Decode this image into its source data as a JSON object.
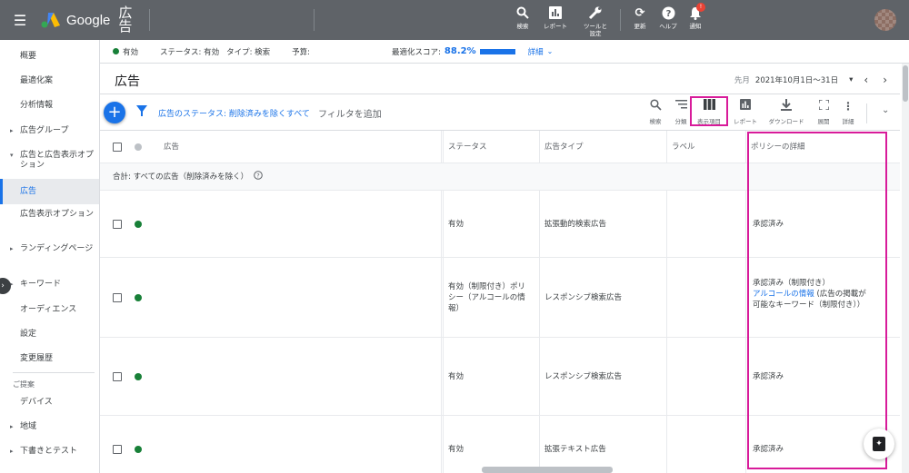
{
  "topbar": {
    "logo_text": "Google",
    "product": "広告",
    "tools": [
      {
        "icon": "search-icon",
        "label": "検索"
      },
      {
        "icon": "reports-icon",
        "label": "レポート"
      },
      {
        "icon": "wrench-icon",
        "label": "ツールと設定"
      },
      {
        "icon": "refresh-icon",
        "label": "更新"
      },
      {
        "icon": "help-icon",
        "label": "ヘルプ"
      },
      {
        "icon": "bell-icon",
        "label": "通知",
        "badge": "!"
      }
    ]
  },
  "sidebar": {
    "items": [
      {
        "label": "概要"
      },
      {
        "label": "最適化案"
      },
      {
        "label": "分析情報"
      },
      {
        "label": "広告グループ"
      },
      {
        "label": "広告と広告表示オプション"
      },
      {
        "label": "広告"
      },
      {
        "label": "広告表示オプション"
      },
      {
        "label": "ランディングページ"
      },
      {
        "label": "キーワード"
      },
      {
        "label": "オーディエンス"
      },
      {
        "label": "設定"
      },
      {
        "label": "変更履歴"
      },
      {
        "label": "デバイス"
      },
      {
        "label": "地域"
      },
      {
        "label": "下書きとテスト"
      }
    ],
    "section_label": "ご提案"
  },
  "statusbar": {
    "status": "有効",
    "status_label": "ステータス: 有効",
    "type_label": "タイプ: 検索",
    "budget_label": "予算:",
    "score_label": "最適化スコア:",
    "score_value": "88.2%",
    "score_fraction": 0.882,
    "details": "詳細"
  },
  "header": {
    "title": "広告",
    "date_prefix": "先月",
    "date_range": "2021年10月1日～31日"
  },
  "toolbar": {
    "filter_text": "広告のステータス: 削除済みを除くすべて",
    "add_filter": "フィルタを追加",
    "buttons": [
      {
        "icon": "search-icon",
        "label": "検索"
      },
      {
        "icon": "segment-icon",
        "label": "分類"
      },
      {
        "icon": "columns-icon",
        "label": "表示項目"
      },
      {
        "icon": "reports-icon",
        "label": "レポート"
      },
      {
        "icon": "download-icon",
        "label": "ダウンロード"
      },
      {
        "icon": "expand-icon",
        "label": "展開"
      },
      {
        "icon": "more-icon",
        "label": "詳細"
      }
    ]
  },
  "table": {
    "headers": {
      "ad": "広告",
      "status": "ステータス",
      "ad_type": "広告タイプ",
      "label": "ラベル",
      "policy": "ポリシーの詳細"
    },
    "total_row": "合計: すべての広告（削除済みを除く）",
    "rows": [
      {
        "status": "有効",
        "ad_type": "拡張動的検索広告",
        "policy": "承認済み"
      },
      {
        "status": "有効（制限付き）ポリシー（アルコールの情報）",
        "ad_type": "レスポンシブ検索広告",
        "policy_prefix": "承認済み（制限付き）",
        "policy_link": "アルコールの情報",
        "policy_suffix": "(広告の掲載が可能なキーワード（制限付き））"
      },
      {
        "status": "有効",
        "ad_type": "レスポンシブ検索広告",
        "policy": "承認済み"
      },
      {
        "status": "有効",
        "ad_type": "拡張テキスト広告",
        "policy": "承認済み"
      }
    ]
  }
}
